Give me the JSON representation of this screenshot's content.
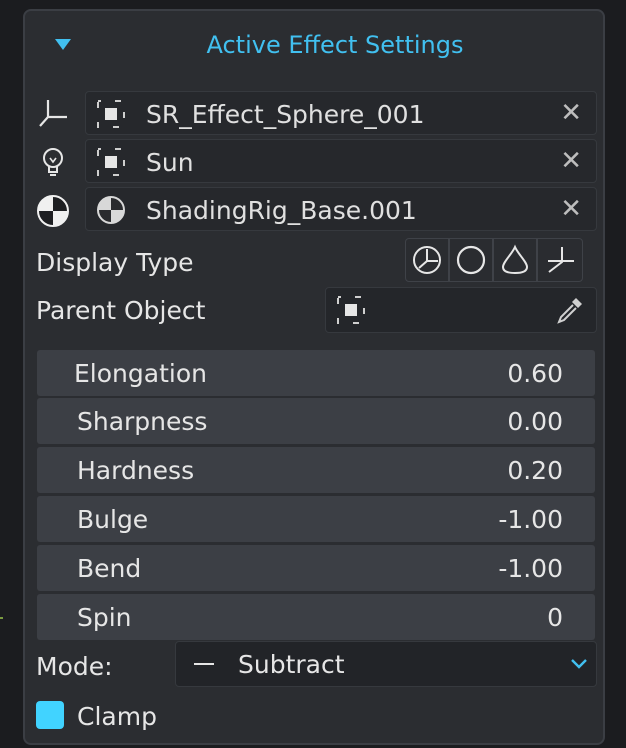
{
  "panel": {
    "title": "Active Effect Settings",
    "accent_color": "#41c0f0"
  },
  "objects": [
    {
      "left_icon": "empty-axes-icon",
      "item_icon": "object-icon",
      "name": "SR_Effect_Sphere_001",
      "remove_icon": "close-icon"
    },
    {
      "left_icon": "light-bulb-icon",
      "item_icon": "object-icon",
      "name": "Sun",
      "remove_icon": "close-icon"
    },
    {
      "left_icon": "shading-sphere-icon",
      "item_icon": "shading-sphere-icon",
      "name": "ShadingRig_Base.001",
      "remove_icon": "close-icon"
    }
  ],
  "display_type": {
    "label": "Display Type",
    "options": [
      "sphere-axes-icon",
      "circle-icon",
      "cone-icon",
      "plain-axes-icon"
    ]
  },
  "parent_object": {
    "label": "Parent Object",
    "value": "",
    "field_icon": "object-icon",
    "picker_icon": "eyedropper-icon"
  },
  "sliders": [
    {
      "name": "Elongation",
      "value": "0.60"
    },
    {
      "name": "Sharpness",
      "value": "0.00"
    },
    {
      "name": "Hardness",
      "value": "0.20"
    },
    {
      "name": "Bulge",
      "value": "-1.00"
    },
    {
      "name": "Bend",
      "value": "-1.00"
    },
    {
      "name": "Spin",
      "value": "0"
    }
  ],
  "mode": {
    "label": "Mode:",
    "value": "Subtract",
    "value_icon": "minus-icon",
    "dropdown_icon": "chevron-down-icon"
  },
  "clamp": {
    "label": "Clamp",
    "checked": true,
    "color": "#41d3ff"
  }
}
